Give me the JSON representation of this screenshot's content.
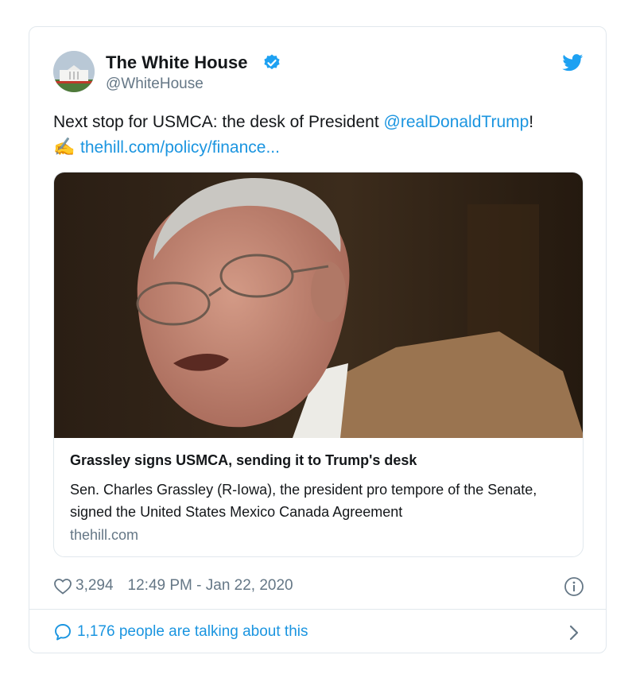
{
  "tweet": {
    "author_name": "The White House",
    "author_handle": "@WhiteHouse",
    "text_before": "Next stop for USMCA: the desk of President ",
    "mention": "@realDonaldTrump",
    "text_after": "!",
    "emoji": "✍",
    "link_text": "thehill.com/policy/finance..."
  },
  "link_card": {
    "title": "Grassley signs USMCA, sending it to Trump's desk",
    "description": "Sen. Charles Grassley (R-Iowa), the president pro tempore of the Senate, signed the United States Mexico Canada Agreement",
    "domain": "thehill.com"
  },
  "meta": {
    "likes": "3,294",
    "timestamp": "12:49 PM - Jan 22, 2020"
  },
  "footer": {
    "talking": "1,176 people are talking about this"
  },
  "icons": {
    "verified": "verified-badge-icon",
    "brand": "twitter-bird-icon",
    "like": "heart-icon",
    "info": "info-icon",
    "reply": "speech-bubble-icon",
    "more": "chevron-right-icon"
  },
  "colors": {
    "accent": "#1b95e0",
    "muted": "#657786",
    "text": "#14171a",
    "border": "#e1e8ed"
  }
}
